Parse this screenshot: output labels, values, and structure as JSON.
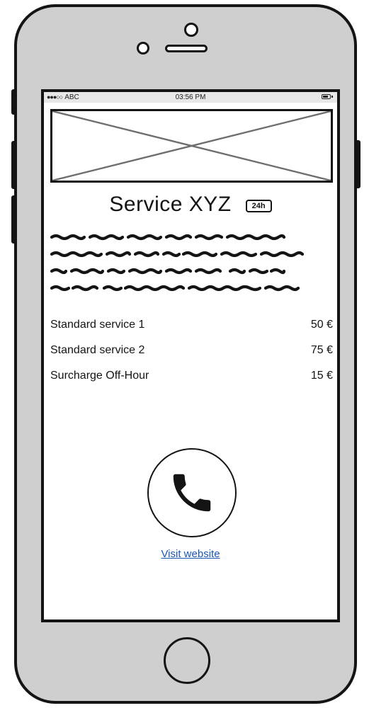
{
  "status_bar": {
    "signal": "●●●○○",
    "carrier": "ABC",
    "time": "03:56 PM"
  },
  "hero": {
    "icon": "image-placeholder-icon"
  },
  "service": {
    "title": "Service XYZ",
    "badge": "24h"
  },
  "description": {
    "line_count": 4,
    "content": "scribbled placeholder text"
  },
  "prices": [
    {
      "label": "Standard service 1",
      "value": "50 €"
    },
    {
      "label": "Standard service 2",
      "value": "75 €"
    },
    {
      "label": "Surcharge Off-Hour",
      "value": "15 €"
    }
  ],
  "actions": {
    "call_icon": "phone-icon",
    "visit_link": "Visit website"
  },
  "colors": {
    "frame": "#141414",
    "phone_body": "#cfcfcf",
    "link": "#1a57b5"
  }
}
